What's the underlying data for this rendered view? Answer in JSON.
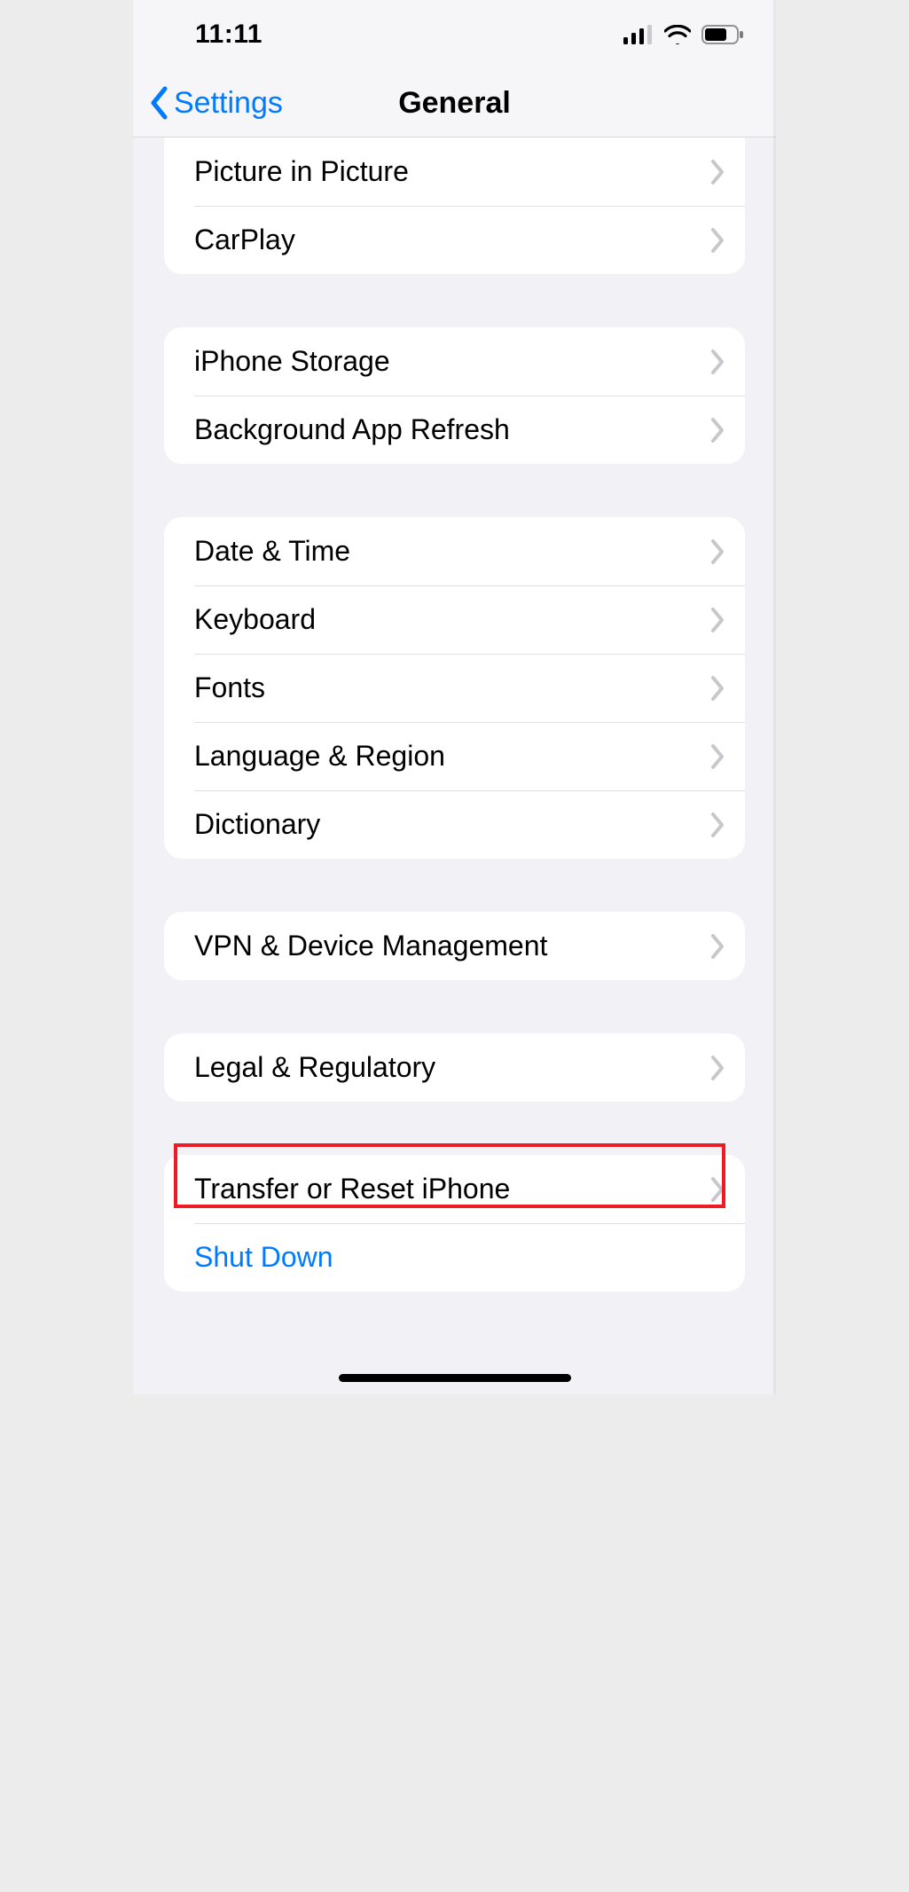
{
  "status": {
    "time": "11:11"
  },
  "nav": {
    "back_label": "Settings",
    "title": "General"
  },
  "groups": [
    {
      "id": "g0",
      "rows": [
        {
          "id": "picture-in-picture",
          "label": "Picture in Picture",
          "chevron": true
        },
        {
          "id": "carplay",
          "label": "CarPlay",
          "chevron": true
        }
      ]
    },
    {
      "id": "g1",
      "rows": [
        {
          "id": "iphone-storage",
          "label": "iPhone Storage",
          "chevron": true
        },
        {
          "id": "background-app-refresh",
          "label": "Background App Refresh",
          "chevron": true
        }
      ]
    },
    {
      "id": "g2",
      "rows": [
        {
          "id": "date-time",
          "label": "Date & Time",
          "chevron": true
        },
        {
          "id": "keyboard",
          "label": "Keyboard",
          "chevron": true
        },
        {
          "id": "fonts",
          "label": "Fonts",
          "chevron": true
        },
        {
          "id": "language-region",
          "label": "Language & Region",
          "chevron": true
        },
        {
          "id": "dictionary",
          "label": "Dictionary",
          "chevron": true
        }
      ]
    },
    {
      "id": "g3",
      "rows": [
        {
          "id": "vpn-device-management",
          "label": "VPN & Device Management",
          "chevron": true
        }
      ]
    },
    {
      "id": "g4",
      "rows": [
        {
          "id": "legal-regulatory",
          "label": "Legal & Regulatory",
          "chevron": true
        }
      ]
    },
    {
      "id": "g5",
      "rows": [
        {
          "id": "transfer-reset",
          "label": "Transfer or Reset iPhone",
          "chevron": true,
          "highlighted": true
        },
        {
          "id": "shut-down",
          "label": "Shut Down",
          "chevron": false,
          "link": true
        }
      ]
    }
  ],
  "colors": {
    "tint": "#007aff",
    "separator": "rgba(0,0,0,0.12)",
    "bg": "#f2f2f6",
    "highlight": "#ed1c24"
  }
}
